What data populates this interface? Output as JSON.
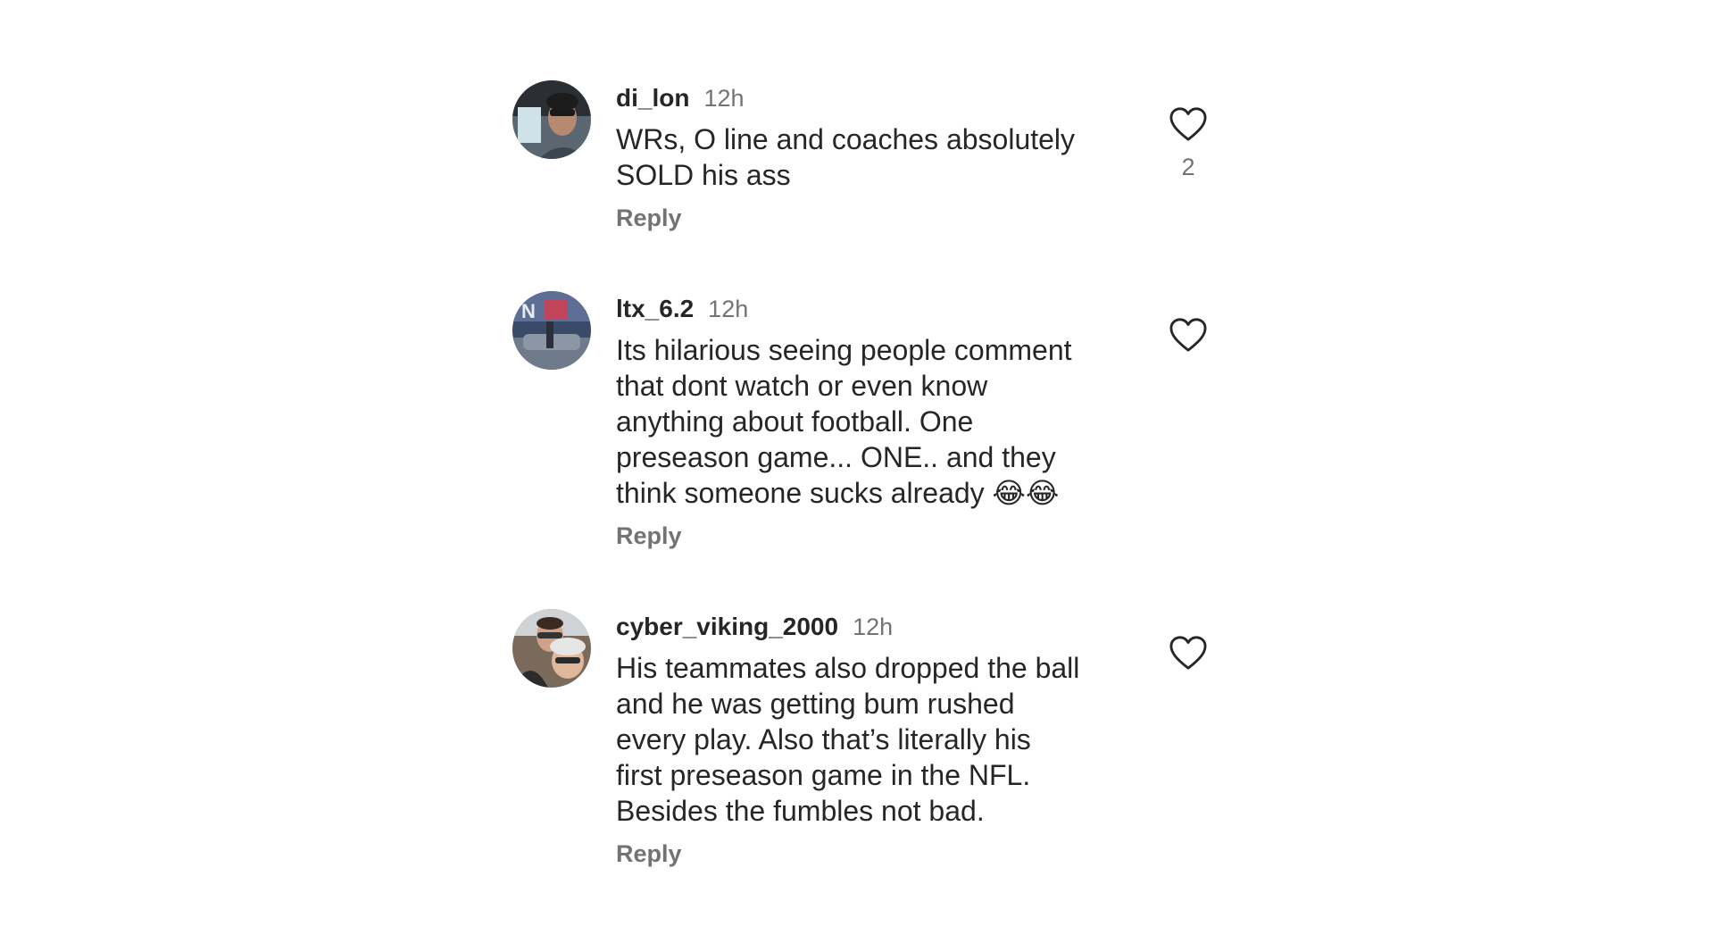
{
  "comments": [
    {
      "username": "di_lon",
      "time": "12h",
      "text": "WRs, O line and coaches absolutely\nSOLD his ass",
      "reply_label": "Reply",
      "like_count": "2",
      "avatar_icon": "avatar-photo"
    },
    {
      "username": "ltx_6.2",
      "time": "12h",
      "text": "Its hilarious seeing people comment\nthat dont watch or even know\nanything about football. One\npreseason game... ONE.. and they\nthink someone sucks already 😂😂",
      "reply_label": "Reply",
      "like_count": "",
      "avatar_icon": "avatar-photo"
    },
    {
      "username": "cyber_viking_2000",
      "time": "12h",
      "text": "His teammates also dropped the ball\nand he was getting bum rushed\nevery play. Also that’s literally his\nfirst preseason game in the NFL.\nBesides the fumbles not bad.",
      "reply_label": "Reply",
      "like_count": "",
      "avatar_icon": "avatar-photo"
    }
  ],
  "icons": {
    "like": "heart-outline-icon"
  },
  "colors": {
    "text": "#262626",
    "muted": "#737373",
    "background": "#ffffff"
  }
}
